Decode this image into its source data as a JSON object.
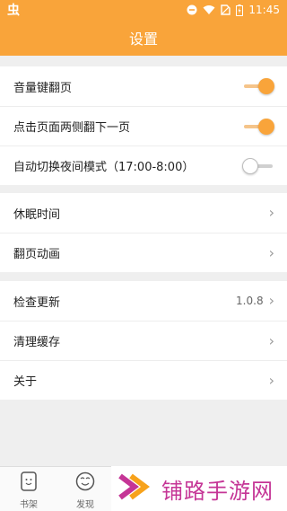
{
  "statusbar": {
    "app_logo": "虫",
    "time": "11:45",
    "icons": [
      "minus-circle-icon",
      "wifi-icon",
      "sim-off-icon",
      "battery-charging-icon"
    ]
  },
  "header": {
    "title": "设置"
  },
  "sections": [
    {
      "rows": [
        {
          "label": "音量键翻页",
          "control": "toggle",
          "on": true
        },
        {
          "label": "点击页面两侧翻下一页",
          "control": "toggle",
          "on": true
        },
        {
          "label": "自动切换夜间模式（17:00-8:00）",
          "control": "toggle",
          "on": false
        }
      ]
    },
    {
      "rows": [
        {
          "label": "休眠时间",
          "control": "chevron"
        },
        {
          "label": "翻页动画",
          "control": "chevron"
        }
      ]
    },
    {
      "rows": [
        {
          "label": "检查更新",
          "control": "chevron",
          "value": "1.0.8"
        },
        {
          "label": "清理缓存",
          "control": "chevron"
        },
        {
          "label": "关于",
          "control": "chevron"
        }
      ]
    }
  ],
  "bottom_tabs": [
    {
      "label": "书架",
      "icon": "bookshelf-icon"
    },
    {
      "label": "发现",
      "icon": "discover-icon"
    }
  ],
  "watermark": {
    "text": "铺路手游网"
  },
  "colors": {
    "accent": "#f9a43a",
    "accent_light": "#f5c48a",
    "background": "#efefef",
    "watermark": "#c53596"
  }
}
